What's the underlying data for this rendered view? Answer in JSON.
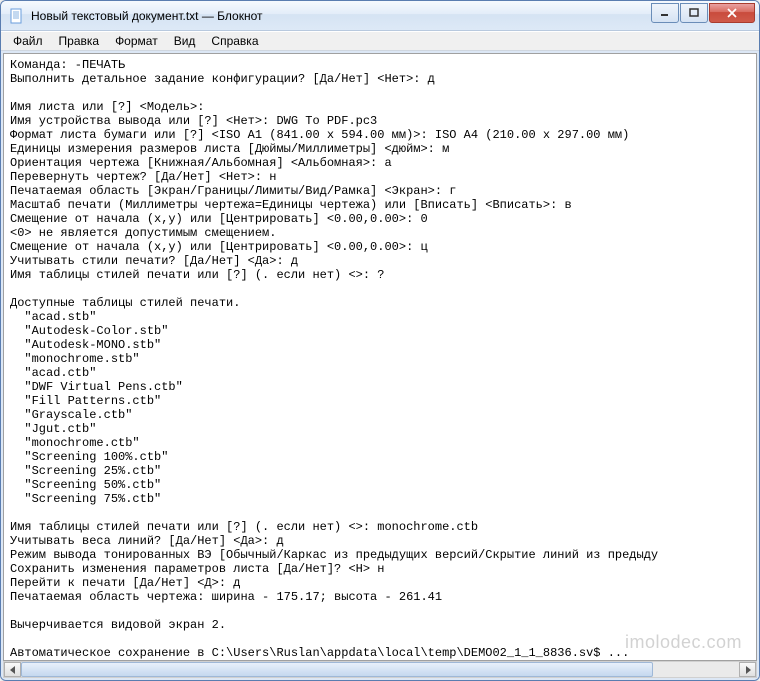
{
  "window": {
    "title": "Новый текстовый документ.txt — Блокнот"
  },
  "menu": {
    "file": "Файл",
    "edit": "Правка",
    "format": "Формат",
    "view": "Вид",
    "help": "Справка"
  },
  "content": {
    "text": "Команда: -ПЕЧАТЬ\nВыполнить детальное задание конфигурации? [Да/Нет] <Нет>: д\n\nИмя листа или [?] <Модель>:\nИмя устройства вывода или [?] <Нет>: DWG To PDF.pc3\nФормат листа бумаги или [?] <ISO A1 (841.00 x 594.00 мм)>: ISO A4 (210.00 x 297.00 мм)\nЕдиницы измерения размеров листа [Дюймы/Миллиметры] <дюйм>: м\nОриентация чертежа [Книжная/Альбомная] <Альбомная>: а\nПеревернуть чертеж? [Да/Нет] <Нет>: н\nПечатаемая область [Экран/Границы/Лимиты/Вид/Рамка] <Экран>: г\nМасштаб печати (Миллиметры чертежа=Единицы чертежа) или [Вписать] <Вписать>: в\nСмещение от начала (x,y) или [Центрировать] <0.00,0.00>: 0\n<0> не является допустимым смещением.\nСмещение от начала (x,y) или [Центрировать] <0.00,0.00>: ц\nУчитывать стили печати? [Да/Нет] <Да>: д\nИмя таблицы стилей печати или [?] (. если нет) <>: ?\n\nДоступные таблицы стилей печати.\n  \"acad.stb\"\n  \"Autodesk-Color.stb\"\n  \"Autodesk-MONO.stb\"\n  \"monochrome.stb\"\n  \"acad.ctb\"\n  \"DWF Virtual Pens.ctb\"\n  \"Fill Patterns.ctb\"\n  \"Grayscale.ctb\"\n  \"Jgut.ctb\"\n  \"monochrome.ctb\"\n  \"Screening 100%.ctb\"\n  \"Screening 25%.ctb\"\n  \"Screening 50%.ctb\"\n  \"Screening 75%.ctb\"\n\nИмя таблицы стилей печати или [?] (. если нет) <>: monochrome.ctb\nУчитывать веса линий? [Да/Нет] <Да>: д\nРежим вывода тонированных ВЭ [Обычный/Каркас из предыдущих версий/Скрытие линий из предыду\nСохранить изменения параметров листа [Да/Нет]? <Н> н\nПерейти к печати [Да/Нет] <Д>: д\nПечатаемая область чертежа: ширина - 175.17; высота - 261.41\n\nВычерчивается видовой экран 2.\n\nАвтоматическое сохранение в C:\\Users\\Ruslan\\appdata\\local\\temp\\DEMO02_1_1_8836.sv$ ..."
  },
  "watermark": "imolodec.com"
}
